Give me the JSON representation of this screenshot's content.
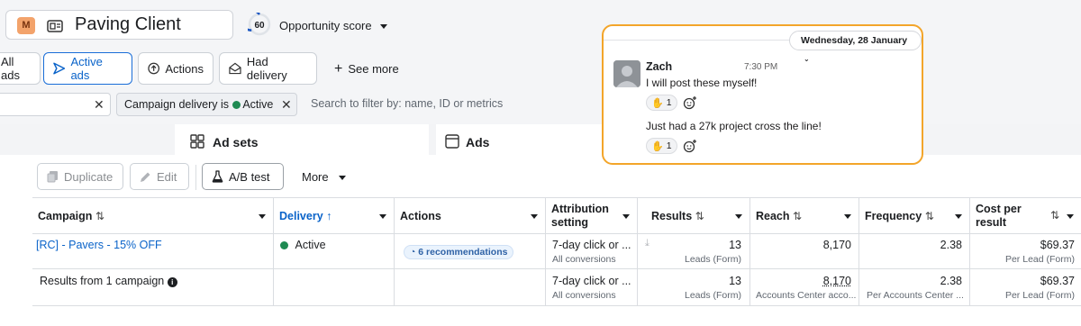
{
  "account": {
    "avatar_letter": "M",
    "name": "Paving Client",
    "avatar_color": "#f3a36b"
  },
  "opportunity": {
    "score": "60",
    "label": "Opportunity score"
  },
  "tabs": [
    {
      "label": "All ads"
    },
    {
      "label": "Active ads"
    },
    {
      "label": "Actions"
    },
    {
      "label": "Had delivery"
    },
    {
      "label": "See more"
    }
  ],
  "filters": {
    "chip_prefix": "Campaign delivery is",
    "chip_value": "Active",
    "search_placeholder": "Search to filter by: name, ID or metrics"
  },
  "panels": {
    "adsets": "Ad sets",
    "ads": "Ads"
  },
  "toolbar": {
    "duplicate": "Duplicate",
    "edit": "Edit",
    "ab_test": "A/B test",
    "more": "More"
  },
  "table": {
    "headers": {
      "campaign": "Campaign",
      "delivery": "Delivery",
      "actions": "Actions",
      "attribution_1": "Attribution",
      "attribution_2": "setting",
      "results": "Results",
      "reach": "Reach",
      "frequency": "Frequency",
      "cost_1": "Cost per",
      "cost_2": "result"
    },
    "row1": {
      "campaign": "[RC] - Pavers - 15% OFF",
      "delivery": "Active",
      "actions": "6 recommendations",
      "attribution": "7-day click or ...",
      "attribution_sub": "All conversions",
      "results": "13",
      "results_sub": "Leads (Form)",
      "reach": "8,170",
      "frequency": "2.38",
      "cost": "$69.37",
      "cost_sub": "Per Lead (Form)"
    },
    "row2": {
      "campaign": "Results from 1 campaign",
      "attribution": "7-day click or ...",
      "attribution_sub": "All conversions",
      "results": "13",
      "results_sub": "Leads (Form)",
      "reach": "8,170",
      "reach_sub": "Accounts Center acco...",
      "frequency": "2.38",
      "frequency_sub": "Per Accounts Center ...",
      "cost": "$69.37",
      "cost_sub": "Per Lead (Form)"
    }
  },
  "chat": {
    "date": "Wednesday, 28 January",
    "name": "Zach",
    "time": "7:30 PM",
    "messages": [
      {
        "text": "I will post these myself!",
        "reaction_count": "1"
      },
      {
        "text": "Just had a 27k project cross the line!",
        "reaction_count": "1"
      }
    ],
    "border_color": "#f3a52a"
  },
  "colors": {
    "accent": "#0a63c9",
    "active_green": "#1e8a52"
  }
}
